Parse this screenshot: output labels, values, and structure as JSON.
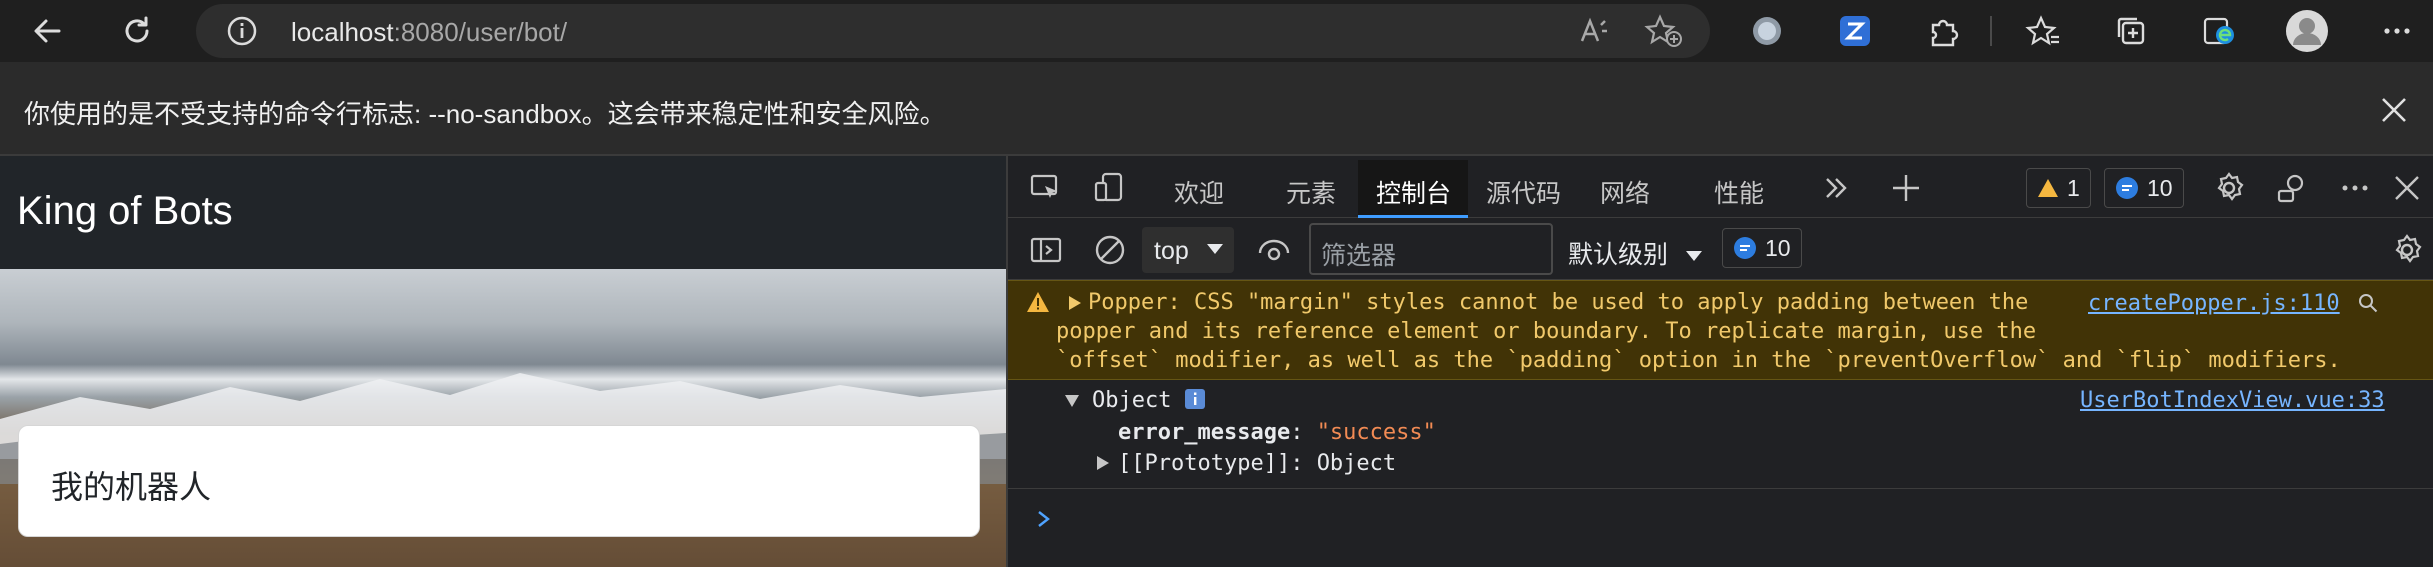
{
  "browser": {
    "url_host": "localhost",
    "url_path": ":8080/user/bot/",
    "info_message": "你使用的是不受支持的命令行标志: --no-sandbox。这会带来稳定性和安全风险。"
  },
  "page": {
    "brand": "King of Bots",
    "card_title": "我的机器人"
  },
  "devtools": {
    "tabs": [
      "欢迎",
      "元素",
      "控制台",
      "源代码",
      "网络",
      "性能"
    ],
    "active_tab": "控制台",
    "warning_count": "1",
    "message_count": "10",
    "context": "top",
    "filter_placeholder": "筛选器",
    "levels_label": "默认级别",
    "levels_count": "10",
    "warning_lines": [
      "Popper: CSS \"margin\" styles cannot be used to apply padding between the",
      "popper and its reference element or boundary. To replicate margin, use the",
      "`offset` modifier, as well as the `padding` option in the `preventOverflow` and `flip` modifiers."
    ],
    "warning_source": "createPopper.js:110",
    "object_label": "Object",
    "object_source": "UserBotIndexView.vue:33",
    "prop_key": "error_message",
    "prop_value": "\"success\"",
    "proto_key": "[[Prototype]]",
    "proto_value": "Object"
  },
  "colors": {
    "accent": "#3f9dff",
    "warning_bg": "#413306",
    "warning_text": "#f1c96b",
    "link": "#76b5ff",
    "string_value": "#f28b54"
  }
}
